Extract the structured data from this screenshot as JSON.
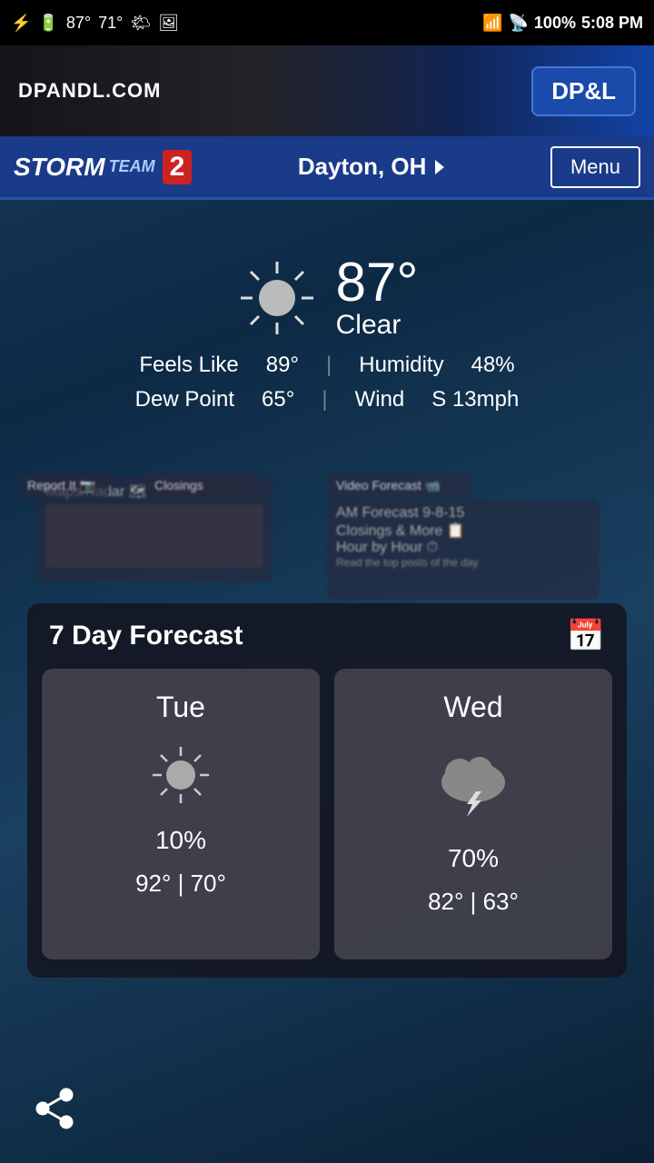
{
  "statusBar": {
    "temperature": "87°",
    "tempLow": "71°",
    "battery": "100%",
    "time": "5:08 PM"
  },
  "adBanner": {
    "text": "DPANDL.COM",
    "logo": "DP&L"
  },
  "header": {
    "appName": "STORM",
    "teamLabel": "TEAM",
    "channelNumber": "2",
    "location": "Dayton, OH",
    "menuLabel": "Menu"
  },
  "currentWeather": {
    "temperature": "87°",
    "condition": "Clear",
    "feelsLike": "89°",
    "humidity": "48%",
    "dewPoint": "65°",
    "wind": "S 13mph",
    "feelsLikeLabel": "Feels Like",
    "humidityLabel": "Humidity",
    "dewPointLabel": "Dew Point",
    "windLabel": "Wind"
  },
  "backgroundCards": {
    "card1": "Report It",
    "card2": "Closings",
    "card3": "Video Forecast",
    "card4": "Maps/Radar",
    "card5": "AM Forecast 9-8-15",
    "card6": "Closings & More",
    "card7": "Hour by Hour",
    "card8": "Read the top posts of the day"
  },
  "forecast": {
    "title": "7 Day Forecast",
    "days": [
      {
        "name": "Tue",
        "iconType": "sun",
        "precipChance": "10%",
        "high": "92°",
        "low": "70°"
      },
      {
        "name": "Wed",
        "iconType": "thunderstorm",
        "precipChance": "70%",
        "high": "82°",
        "low": "63°"
      }
    ]
  },
  "shareButton": {
    "label": "Share"
  }
}
